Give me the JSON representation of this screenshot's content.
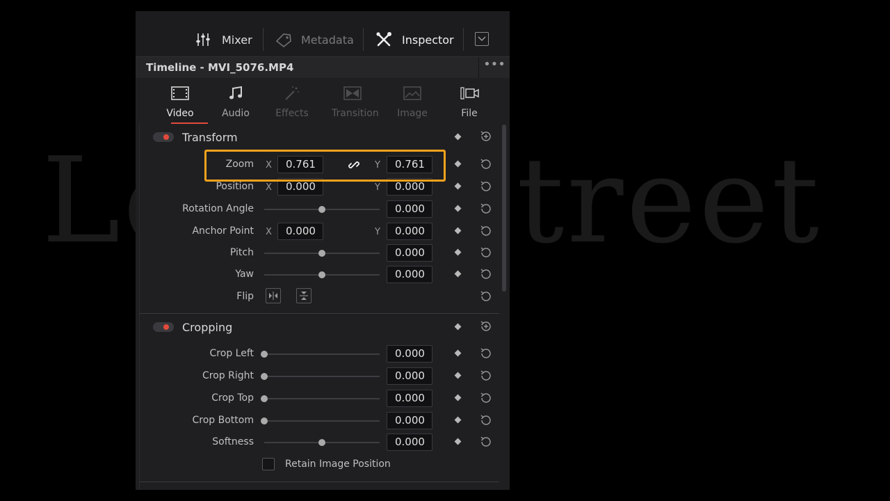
{
  "watermark": "Louisastreet",
  "toolbar": {
    "mixer_label": "Mixer",
    "metadata_label": "Metadata",
    "inspector_label": "Inspector"
  },
  "title": "Timeline - MVI_5076.MP4",
  "menu_dots": "•••",
  "tabs": [
    {
      "label": "Video",
      "state": "active"
    },
    {
      "label": "Audio",
      "state": "enabled"
    },
    {
      "label": "Effects",
      "state": "disabled"
    },
    {
      "label": "Transition",
      "state": "disabled"
    },
    {
      "label": "Image",
      "state": "disabled"
    },
    {
      "label": "File",
      "state": "enabled"
    }
  ],
  "transform": {
    "title": "Transform",
    "zoom": {
      "label": "Zoom",
      "x_axis": "X",
      "x": "0.761",
      "y_axis": "Y",
      "y": "0.761"
    },
    "position": {
      "label": "Position",
      "x_axis": "X",
      "x": "0.000",
      "y_axis": "Y",
      "y": "0.000"
    },
    "rotation": {
      "label": "Rotation Angle",
      "value": "0.000"
    },
    "anchor": {
      "label": "Anchor Point",
      "x_axis": "X",
      "x": "0.000",
      "y_axis": "Y",
      "y": "0.000"
    },
    "pitch": {
      "label": "Pitch",
      "value": "0.000"
    },
    "yaw": {
      "label": "Yaw",
      "value": "0.000"
    },
    "flip": {
      "label": "Flip"
    }
  },
  "cropping": {
    "title": "Cropping",
    "crop_left": {
      "label": "Crop Left",
      "value": "0.000"
    },
    "crop_right": {
      "label": "Crop Right",
      "value": "0.000"
    },
    "crop_top": {
      "label": "Crop Top",
      "value": "0.000"
    },
    "crop_bottom": {
      "label": "Crop Bottom",
      "value": "0.000"
    },
    "softness": {
      "label": "Softness",
      "value": "0.000"
    },
    "retain_label": "Retain Image Position"
  },
  "colors": {
    "accent_red": "#e24a3b",
    "highlight": "#f6a21c"
  }
}
